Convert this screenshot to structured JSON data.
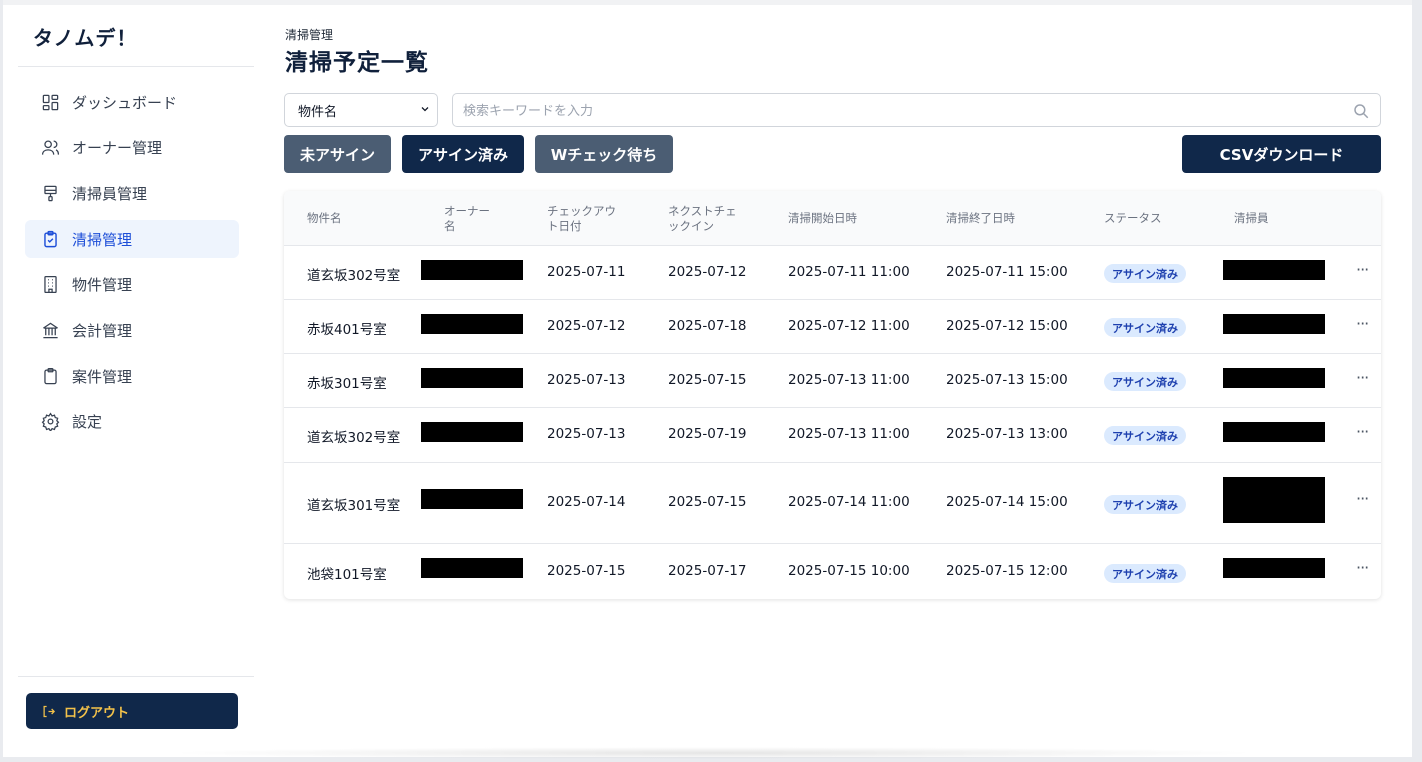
{
  "app": {
    "logo": "タノムデ！"
  },
  "sidebar": {
    "items": [
      {
        "label": "ダッシュボード",
        "icon": "dashboard-icon"
      },
      {
        "label": "オーナー管理",
        "icon": "users-icon"
      },
      {
        "label": "清掃員管理",
        "icon": "brush-icon"
      },
      {
        "label": "清掃管理",
        "icon": "clipboard-check-icon",
        "active": true
      },
      {
        "label": "物件管理",
        "icon": "building-icon"
      },
      {
        "label": "会計管理",
        "icon": "bank-icon"
      },
      {
        "label": "案件管理",
        "icon": "clipboard-icon"
      },
      {
        "label": "設定",
        "icon": "gear-icon"
      }
    ],
    "logout_label": "ログアウト"
  },
  "header": {
    "breadcrumb": "清掃管理",
    "title": "清掃予定一覧"
  },
  "filters": {
    "select_value": "物件名",
    "search_placeholder": "検索キーワードを入力"
  },
  "buttons": {
    "unassigned": "未アサイン",
    "assigned": "アサイン済み",
    "w_check": "Wチェック待ち",
    "csv": "CSVダウンロード"
  },
  "table": {
    "columns": {
      "property": "物件名",
      "owner_line1": "オーナー",
      "owner_line2": "名",
      "checkout_line1": "チェックアウ",
      "checkout_line2": "ト日付",
      "next_line1": "ネクストチェ",
      "next_line2": "ックイン",
      "start": "清掃開始日時",
      "end": "清掃終了日時",
      "status": "ステータス",
      "cleaner": "清掃員"
    },
    "rows": [
      {
        "property": "道玄坂302号室",
        "checkout": "2025-07-11",
        "next_checkin": "2025-07-12",
        "start": "2025-07-11 11:00",
        "end": "2025-07-11 15:00",
        "status": "アサイン済み",
        "more": "···"
      },
      {
        "property": "赤坂401号室",
        "checkout": "2025-07-12",
        "next_checkin": "2025-07-18",
        "start": "2025-07-12 11:00",
        "end": "2025-07-12 15:00",
        "status": "アサイン済み",
        "more": "···"
      },
      {
        "property": "赤坂301号室",
        "checkout": "2025-07-13",
        "next_checkin": "2025-07-15",
        "start": "2025-07-13 11:00",
        "end": "2025-07-13 15:00",
        "status": "アサイン済み",
        "more": "···"
      },
      {
        "property": "道玄坂302号室",
        "checkout": "2025-07-13",
        "next_checkin": "2025-07-19",
        "start": "2025-07-13 11:00",
        "end": "2025-07-13 13:00",
        "status": "アサイン済み",
        "more": "···"
      },
      {
        "property": "道玄坂301号室",
        "checkout": "2025-07-14",
        "next_checkin": "2025-07-15",
        "start": "2025-07-14 11:00",
        "end": "2025-07-14 15:00",
        "status": "アサイン済み",
        "more": "···"
      },
      {
        "property": "池袋101号室",
        "checkout": "2025-07-15",
        "next_checkin": "2025-07-17",
        "start": "2025-07-15 10:00",
        "end": "2025-07-15 12:00",
        "status": "アサイン済み",
        "more": "···"
      }
    ]
  },
  "colors": {
    "navy": "#10284a",
    "slate_button": "#4b5d73",
    "active_nav_bg": "#eef4fd",
    "active_nav_text": "#1d4ed8",
    "badge_bg": "#dbeafe",
    "badge_text": "#1e40af",
    "logout_text": "#f3c24a"
  }
}
